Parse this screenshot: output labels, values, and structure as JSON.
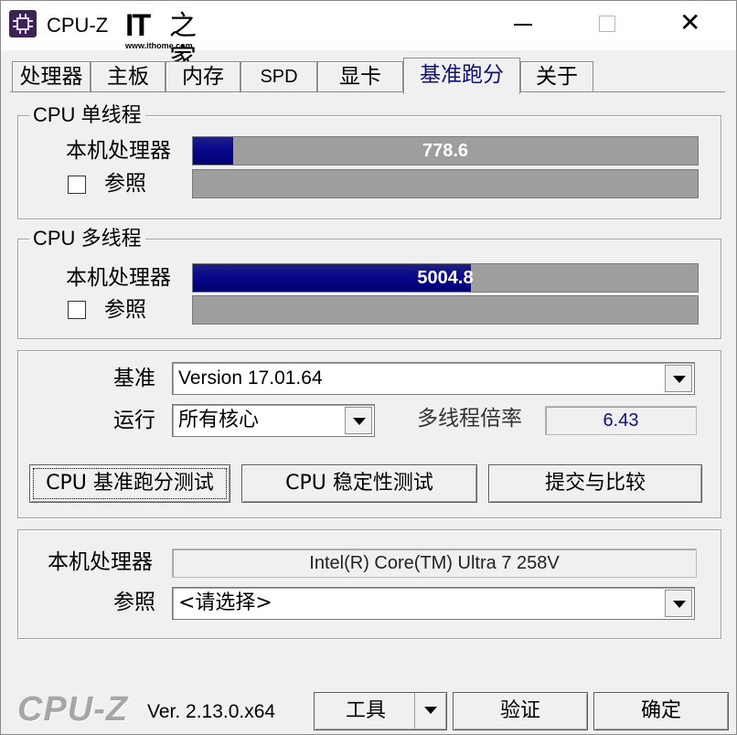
{
  "window": {
    "title": "CPU-Z",
    "logo_it": "IT",
    "logo_zh": "之家",
    "logo_url": "www.ithome.com"
  },
  "tabs": [
    {
      "label": "处理器",
      "active": false
    },
    {
      "label": "主板",
      "active": false
    },
    {
      "label": "内存",
      "active": false
    },
    {
      "label": "SPD",
      "active": false
    },
    {
      "label": "显卡",
      "active": false
    },
    {
      "label": "基准跑分",
      "active": true
    },
    {
      "label": "关于",
      "active": false
    }
  ],
  "single_thread": {
    "title_latin": "CPU",
    "title_zh": "单线程",
    "this_processor_label": "本机处理器",
    "this_processor_value": "778.6",
    "this_processor_fraction": 0.08,
    "reference_label": "参照",
    "reference_checked": false
  },
  "multi_thread": {
    "title_latin": "CPU",
    "title_zh": "多线程",
    "this_processor_label": "本机处理器",
    "this_processor_value": "5004.8",
    "this_processor_fraction": 0.55,
    "reference_label": "参照",
    "reference_checked": false
  },
  "settings": {
    "benchmark_label": "基准",
    "benchmark_value": "Version 17.01.64",
    "run_label": "运行",
    "run_value": "所有核心",
    "ratio_label": "多线程倍率",
    "ratio_value": "6.43",
    "bench_button": "CPU 基准跑分测试",
    "stress_button": "CPU 稳定性测试",
    "submit_button": "提交与比较"
  },
  "info": {
    "this_processor_label": "本机处理器",
    "this_processor_value": "Intel(R) Core(TM) Ultra 7 258V",
    "reference_label": "参照",
    "reference_value": "<请选择>"
  },
  "footer": {
    "brand": "CPU-Z",
    "version": "Ver. 2.13.0.x64",
    "tools_button": "工具",
    "validate_button": "验证",
    "ok_button": "确定"
  }
}
